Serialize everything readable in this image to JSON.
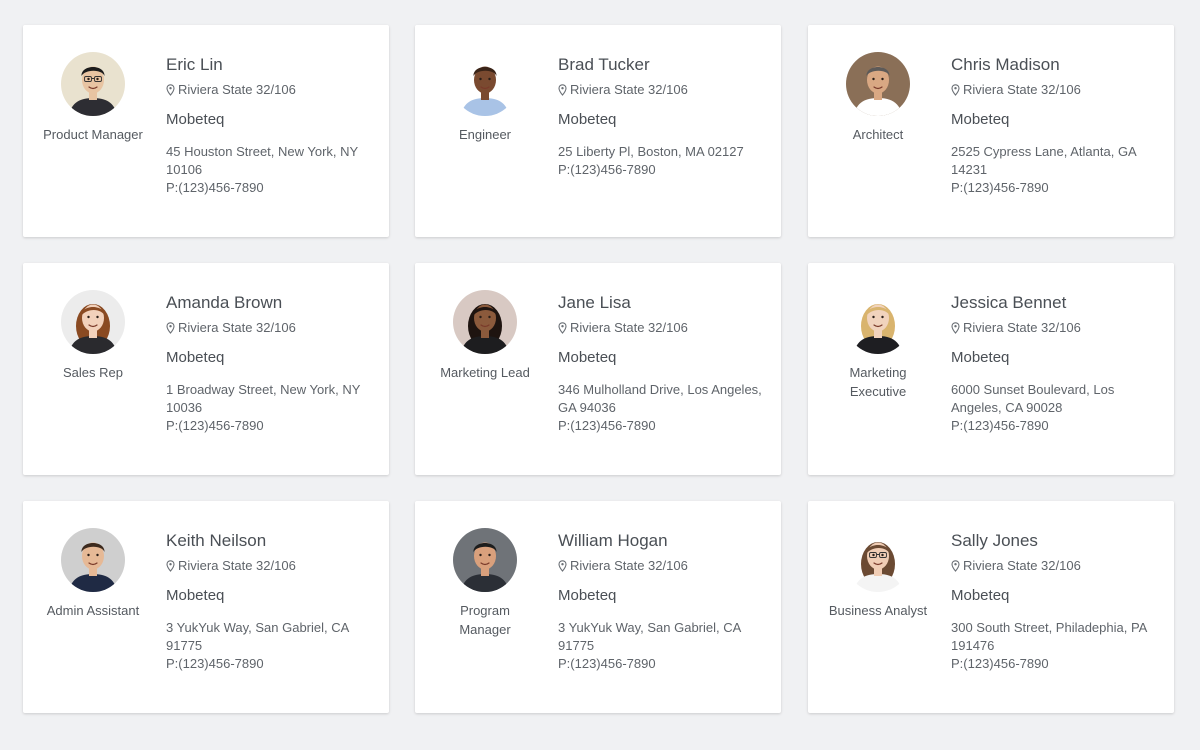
{
  "cards": [
    {
      "name": "Eric Lin",
      "location": "Riviera State 32/106",
      "company": "Mobeteq",
      "address": "45 Houston Street, New York, NY 10106",
      "phone": "P:(123)456-7890",
      "role": "Product Manager",
      "avatar": "man-glasses-photo",
      "skin": "#e8c4a2",
      "hair": "#1c1c1c",
      "suit": "#2d2d33",
      "bg": "#e9e2cf"
    },
    {
      "name": "Brad Tucker",
      "location": "Riviera State 32/106",
      "company": "Mobeteq",
      "address": "25 Liberty Pl, Boston, MA 02127",
      "phone": "P:(123)456-7890",
      "role": "Engineer",
      "avatar": "man-photo",
      "skin": "#7a4a30",
      "hair": "#3a2418",
      "suit": "#a9c3e6",
      "bg": "#ffffff"
    },
    {
      "name": "Chris Madison",
      "location": "Riviera State 32/106",
      "company": "Mobeteq",
      "address": "2525 Cypress Lane, Atlanta, GA 14231",
      "phone": "P:(123)456-7890",
      "role": "Architect",
      "avatar": "man-photo",
      "skin": "#d9a883",
      "hair": "#5d5a58",
      "suit": "#ffffff",
      "bg": "#8a6f57"
    },
    {
      "name": "Amanda Brown",
      "location": "Riviera State 32/106",
      "company": "Mobeteq",
      "address": "1 Broadway Street, New York, NY 10036",
      "phone": "P:(123)456-7890",
      "role": "Sales Rep",
      "avatar": "woman-photo",
      "skin": "#f2d1bb",
      "hair": "#8a4a22",
      "suit": "#2a2a2e",
      "bg": "#ececec"
    },
    {
      "name": "Jane Lisa",
      "location": "Riviera State 32/106",
      "company": "Mobeteq",
      "address": "346 Mulholland Drive, Los Angeles, GA 94036",
      "phone": "P:(123)456-7890",
      "role": "Marketing Lead",
      "avatar": "woman-photo",
      "skin": "#8b5a3c",
      "hair": "#1e1410",
      "suit": "#1d1d1f",
      "bg": "#d8c9c3"
    },
    {
      "name": "Jessica Bennet",
      "location": "Riviera State 32/106",
      "company": "Mobeteq",
      "address": "6000 Sunset Boulevard, Los Angeles, CA 90028",
      "phone": "P:(123)456-7890",
      "role": "Marketing Executive",
      "avatar": "woman-photo",
      "skin": "#f1d3bd",
      "hair": "#d9b46e",
      "suit": "#1e1e22",
      "bg": "#ffffff"
    },
    {
      "name": "Keith Neilson",
      "location": "Riviera State 32/106",
      "company": "Mobeteq",
      "address": "3 YukYuk Way, San Gabriel, CA 91775",
      "phone": "P:(123)456-7890",
      "role": "Admin Assistant",
      "avatar": "man-photo",
      "skin": "#e6b996",
      "hair": "#3c2a1e",
      "suit": "#1f2a44",
      "bg": "#cfcfcf"
    },
    {
      "name": "William Hogan",
      "location": "Riviera State 32/106",
      "company": "Mobeteq",
      "address": "3 YukYuk Way, San Gabriel, CA 91775",
      "phone": "P:(123)456-7890",
      "role": "Program Manager",
      "avatar": "man-photo",
      "skin": "#d9a07c",
      "hair": "#1d1d1d",
      "suit": "#2b2f36",
      "bg": "#6f7378"
    },
    {
      "name": "Sally Jones",
      "location": "Riviera State 32/106",
      "company": "Mobeteq",
      "address": "300 South Street, Philadephia, PA 191476",
      "phone": "P:(123)456-7890",
      "role": "Business Analyst",
      "avatar": "woman-glasses-photo",
      "skin": "#f0cdb5",
      "hair": "#6b4a33",
      "suit": "#f4f4f4",
      "bg": "#ffffff"
    }
  ]
}
